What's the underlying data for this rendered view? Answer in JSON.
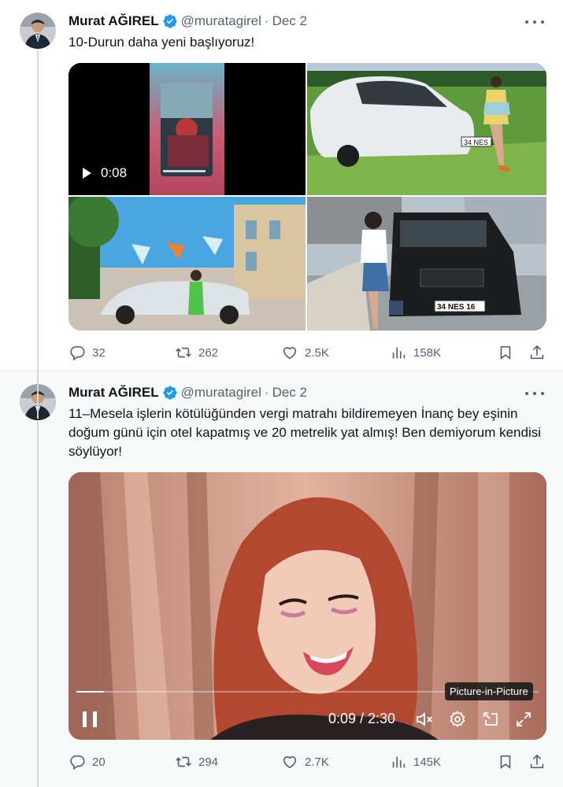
{
  "tweets": [
    {
      "author": {
        "name": "Murat AĞIREL",
        "handle": "@muratagirel",
        "date": "Dec 2",
        "verified": true
      },
      "text": "10-Durun daha yeni başlıyoruz!",
      "media": {
        "video_duration": "0:08",
        "plate_1": "34 NES 16",
        "plate_2": "34 NES 16"
      },
      "stats": {
        "replies": "32",
        "reposts": "262",
        "likes": "2.5K",
        "views": "158K"
      }
    },
    {
      "author": {
        "name": "Murat AĞIREL",
        "handle": "@muratagirel",
        "date": "Dec 2",
        "verified": true
      },
      "text": "11–Mesela işlerin kötülüğünden vergi matrahı bildiremeyen İnanç bey eşinin doğum günü için otel kapatmış ve 20 metrelik yat almış! Ben demiyorum kendisi söylüyor!",
      "video": {
        "time": "0:09 / 2:30",
        "progress": 0.06,
        "tooltip": "Picture-in-Picture"
      },
      "stats": {
        "replies": "20",
        "reposts": "294",
        "likes": "2.7K",
        "views": "145K"
      }
    }
  ],
  "separator": "·",
  "colors": {
    "verified": "#1d9bf0",
    "muted": "#536471",
    "thread_line": "#cfd9de"
  }
}
